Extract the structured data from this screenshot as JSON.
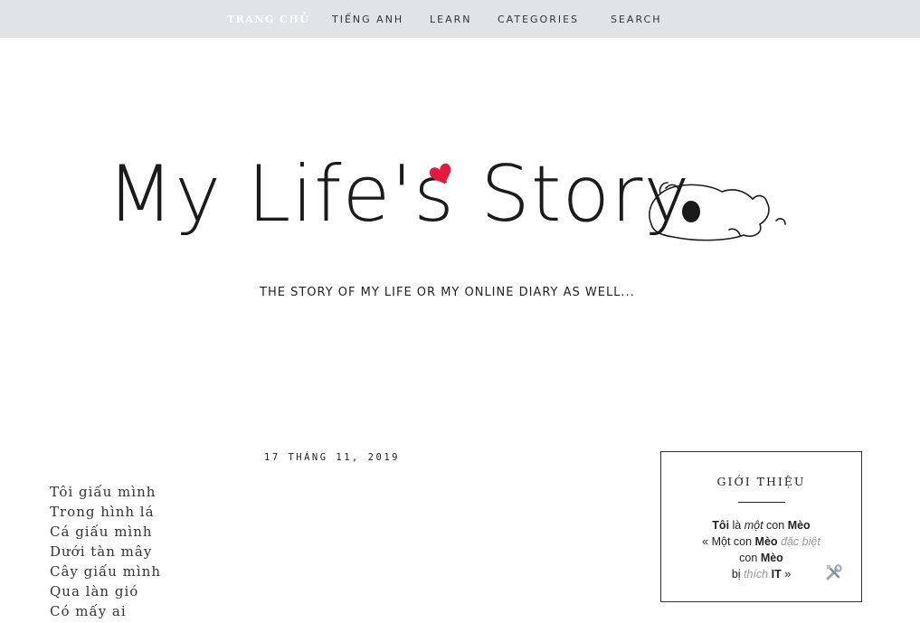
{
  "nav": {
    "items": [
      {
        "label": "TRANG CHỦ",
        "active": true
      },
      {
        "label": "TIẾNG ANH"
      },
      {
        "label": "LEARN"
      },
      {
        "label": "CATEGORIES"
      },
      {
        "label": "SEARCH"
      }
    ]
  },
  "header": {
    "logo_text": "My Life's Story",
    "tagline": "THE STORY OF MY LIFE OR MY ONLINE DIARY AS WELL...",
    "heart_color": "#e8173c"
  },
  "post": {
    "date": "17 THÁNG 11, 2019",
    "lines": [
      "Tôi giấu mình",
      "Trong hình lá",
      "Cá giấu mình",
      "Dưới tàn mây",
      "Cây giấu mình",
      "Qua làn gió",
      "Có mấy ai"
    ]
  },
  "sidebar": {
    "title": "GIỚI THIỆU",
    "l1_a": "Tôi",
    "l1_b": " là ",
    "l1_c": "một",
    "l1_d": " con ",
    "l1_e": "Mèo",
    "l2_a": "« Một con ",
    "l2_b": "Mèo",
    "l2_c": " ",
    "l2_d": "đặc biệt",
    "l3_a": "con ",
    "l3_b": "Mèo",
    "l4_a": "bị ",
    "l4_b": "thích",
    "l4_c": " ",
    "l4_d": "IT",
    "l4_e": " »",
    "icon": "tools-icon"
  }
}
